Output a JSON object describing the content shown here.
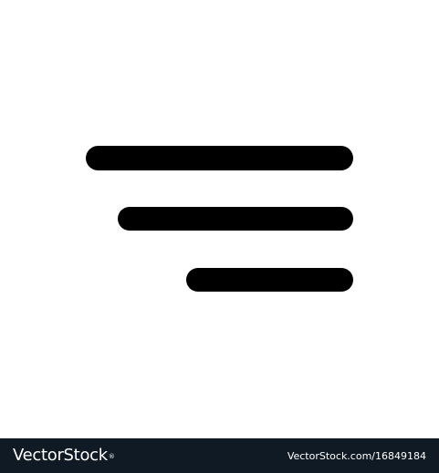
{
  "icon": {
    "name": "menu-align-right-icon",
    "color": "#000000",
    "background": "#ffffff"
  },
  "footer": {
    "brand": "VectorStock",
    "registered_mark": "®",
    "image_ref": "VectorStock.com/16849184",
    "background": "#0f1a24",
    "text_color": "#ffffff"
  }
}
